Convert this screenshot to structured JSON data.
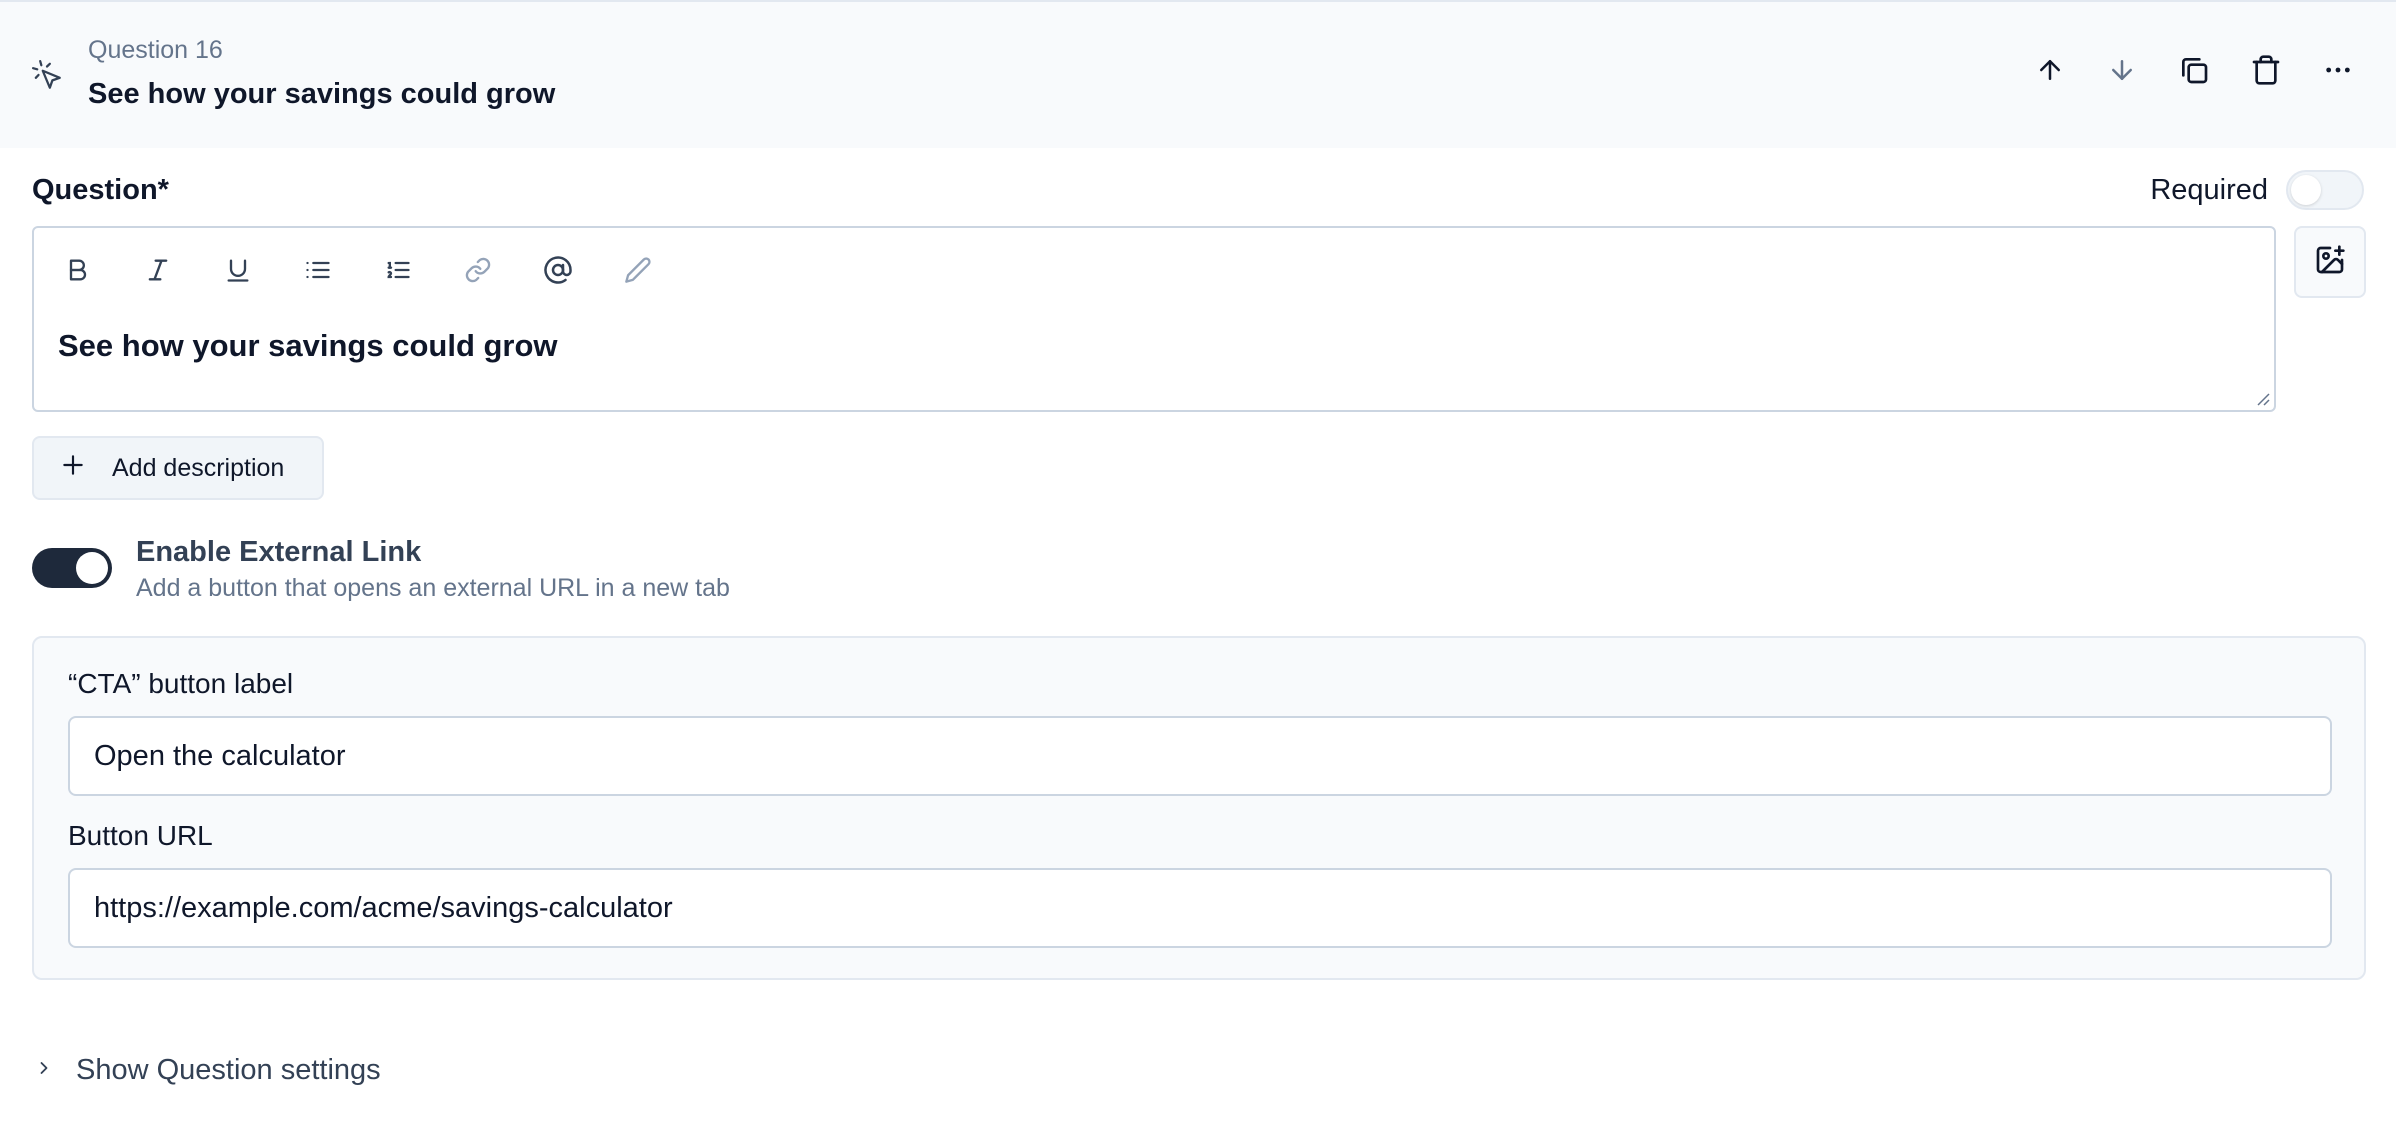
{
  "header": {
    "question_number": "Question 16",
    "question_title": "See how your savings could grow",
    "icon": "cursor-click-icon",
    "actions": [
      "arrow-up-icon",
      "arrow-down-icon",
      "copy-icon",
      "trash-icon",
      "more-horizontal-icon"
    ]
  },
  "question": {
    "label": "Question*",
    "required_label": "Required",
    "required_on": false,
    "toolbar": [
      "bold-icon",
      "italic-icon",
      "underline-icon",
      "bullet-list-icon",
      "numbered-list-icon",
      "link-icon",
      "at-mention-icon",
      "pencil-icon"
    ],
    "content": "See how your savings could grow",
    "image_button": "image-plus-icon"
  },
  "add_description": {
    "label": "Add description"
  },
  "external_link": {
    "enabled": true,
    "title": "Enable External Link",
    "description": "Add a button that opens an external URL in a new tab"
  },
  "cta": {
    "label_title": "“CTA” button label",
    "label_value": "Open the calculator",
    "url_title": "Button URL",
    "url_value": "https://example.com/acme/savings-calculator"
  },
  "settings": {
    "label": "Show Question settings"
  },
  "colors": {
    "header_bg": "#f8fafc",
    "toggle_on": "#1e293b",
    "text_primary": "#0f172a",
    "text_muted": "#64748b"
  }
}
